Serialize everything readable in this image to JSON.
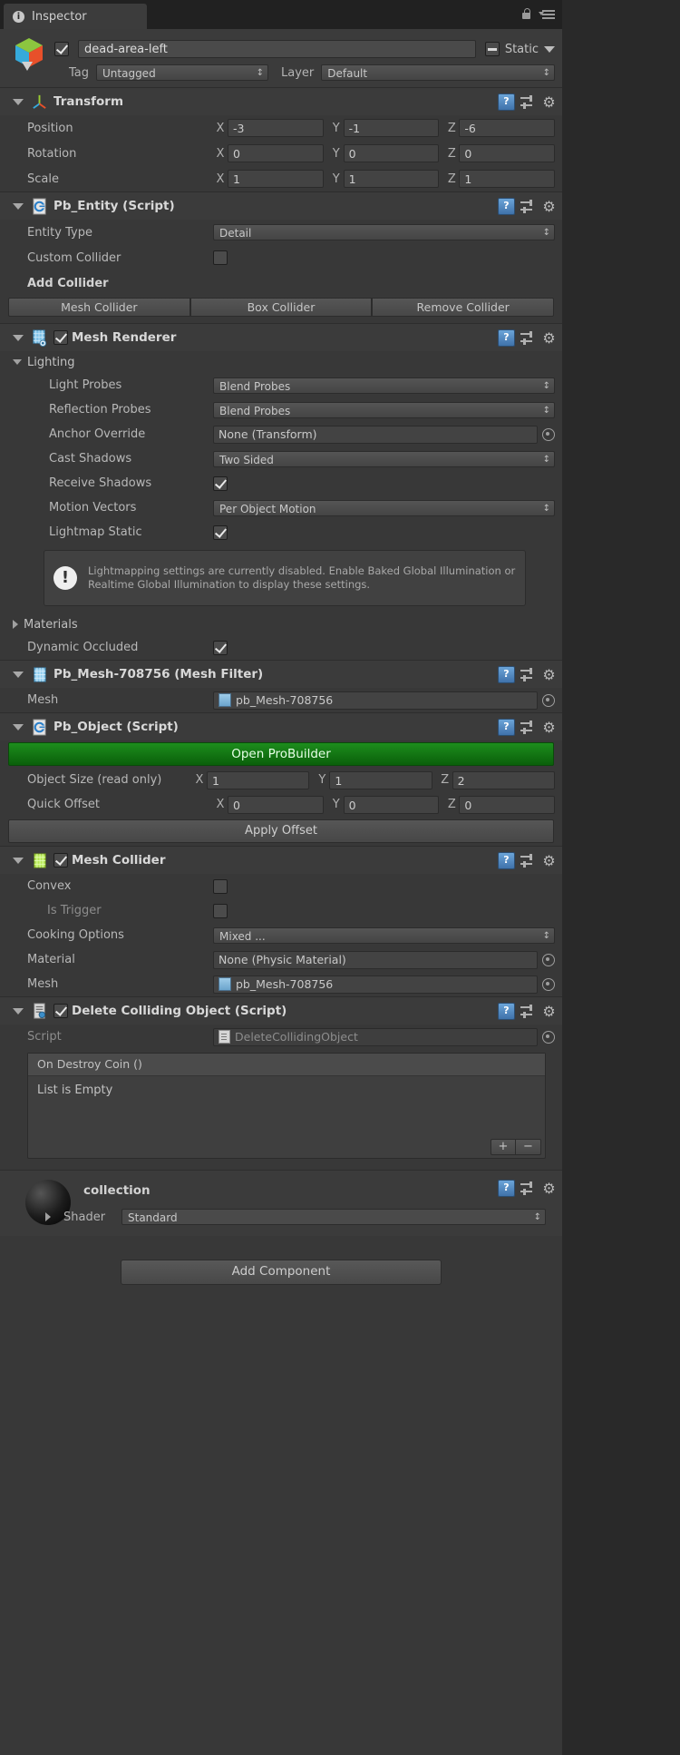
{
  "window": {
    "tab_label": "Inspector",
    "tab_icon": "info-circle-icon",
    "lock_icon": "lock-icon",
    "menu_icon": "hamburger-menu-icon"
  },
  "object_header": {
    "enabled_checkbox": true,
    "name": "dead-area-left",
    "static_label": "Static",
    "static_state": "mixed",
    "tag_label": "Tag",
    "tag_value": "Untagged",
    "layer_label": "Layer",
    "layer_value": "Default"
  },
  "components": [
    {
      "id": "transform",
      "title": "Transform",
      "rows": [
        {
          "label": "Position",
          "x": "-3",
          "y": "-1",
          "z": "-6"
        },
        {
          "label": "Rotation",
          "x": "0",
          "y": "0",
          "z": "0"
        },
        {
          "label": "Scale",
          "x": "1",
          "y": "1",
          "z": "1"
        }
      ]
    },
    {
      "id": "pb_entity",
      "title": "Pb_Entity (Script)",
      "entity_type_label": "Entity Type",
      "entity_type_value": "Detail",
      "custom_collider_label": "Custom Collider",
      "custom_collider_value": false,
      "add_collider_label": "Add Collider",
      "buttons": [
        "Mesh Collider",
        "Box Collider",
        "Remove Collider"
      ]
    },
    {
      "id": "mesh_renderer",
      "title": "Mesh Renderer",
      "enabled": true,
      "lighting_group": "Lighting",
      "rows": [
        {
          "label": "Light Probes",
          "value": "Blend Probes",
          "kind": "dropdown"
        },
        {
          "label": "Reflection Probes",
          "value": "Blend Probes",
          "kind": "dropdown"
        },
        {
          "label": "Anchor Override",
          "value": "None (Transform)",
          "kind": "object"
        },
        {
          "label": "Cast Shadows",
          "value": "Two Sided",
          "kind": "dropdown"
        },
        {
          "label": "Receive Shadows",
          "value": true,
          "kind": "checkbox"
        },
        {
          "label": "Motion Vectors",
          "value": "Per Object Motion",
          "kind": "dropdown"
        },
        {
          "label": "Lightmap Static",
          "value": true,
          "kind": "checkbox"
        }
      ],
      "info_text": "Lightmapping settings are currently disabled. Enable Baked Global Illumination or Realtime Global Illumination to display these settings.",
      "materials_label": "Materials",
      "dynamic_occluded_label": "Dynamic Occluded",
      "dynamic_occluded_value": true
    },
    {
      "id": "mesh_filter",
      "title": "Pb_Mesh-708756 (Mesh Filter)",
      "mesh_label": "Mesh",
      "mesh_value": "pb_Mesh-708756"
    },
    {
      "id": "pb_object",
      "title": "Pb_Object (Script)",
      "open_probuilder_label": "Open ProBuilder",
      "object_size_label": "Object Size (read only)",
      "object_size": {
        "x": "1",
        "y": "1",
        "z": "2"
      },
      "quick_offset_label": "Quick Offset",
      "quick_offset": {
        "x": "0",
        "y": "0",
        "z": "0"
      },
      "apply_offset_label": "Apply Offset"
    },
    {
      "id": "mesh_collider",
      "title": "Mesh Collider",
      "enabled": true,
      "rows": [
        {
          "label": "Convex",
          "value": false,
          "kind": "checkbox"
        },
        {
          "label": "Is Trigger",
          "value": false,
          "kind": "checkbox",
          "dim": true
        },
        {
          "label": "Cooking Options",
          "value": "Mixed ...",
          "kind": "dropdown"
        },
        {
          "label": "Material",
          "value": "None (Physic Material)",
          "kind": "object"
        },
        {
          "label": "Mesh",
          "value": "pb_Mesh-708756",
          "kind": "object-mesh"
        }
      ]
    },
    {
      "id": "delete_colliding_object",
      "title": "Delete Colliding Object (Script)",
      "enabled": true,
      "script_label": "Script",
      "script_value": "DeleteCollidingObject",
      "event_header": "On Destroy Coin ()",
      "event_empty": "List is Empty",
      "add_button": "+",
      "remove_button": "−"
    }
  ],
  "material_preview": {
    "name": "collection",
    "shader_label": "Shader",
    "shader_value": "Standard"
  },
  "footer": {
    "add_component_label": "Add Component"
  },
  "colors": {
    "background": "#383838",
    "probuilder_green": "#0f7a0f",
    "accent_blue": "#4f86c0"
  }
}
